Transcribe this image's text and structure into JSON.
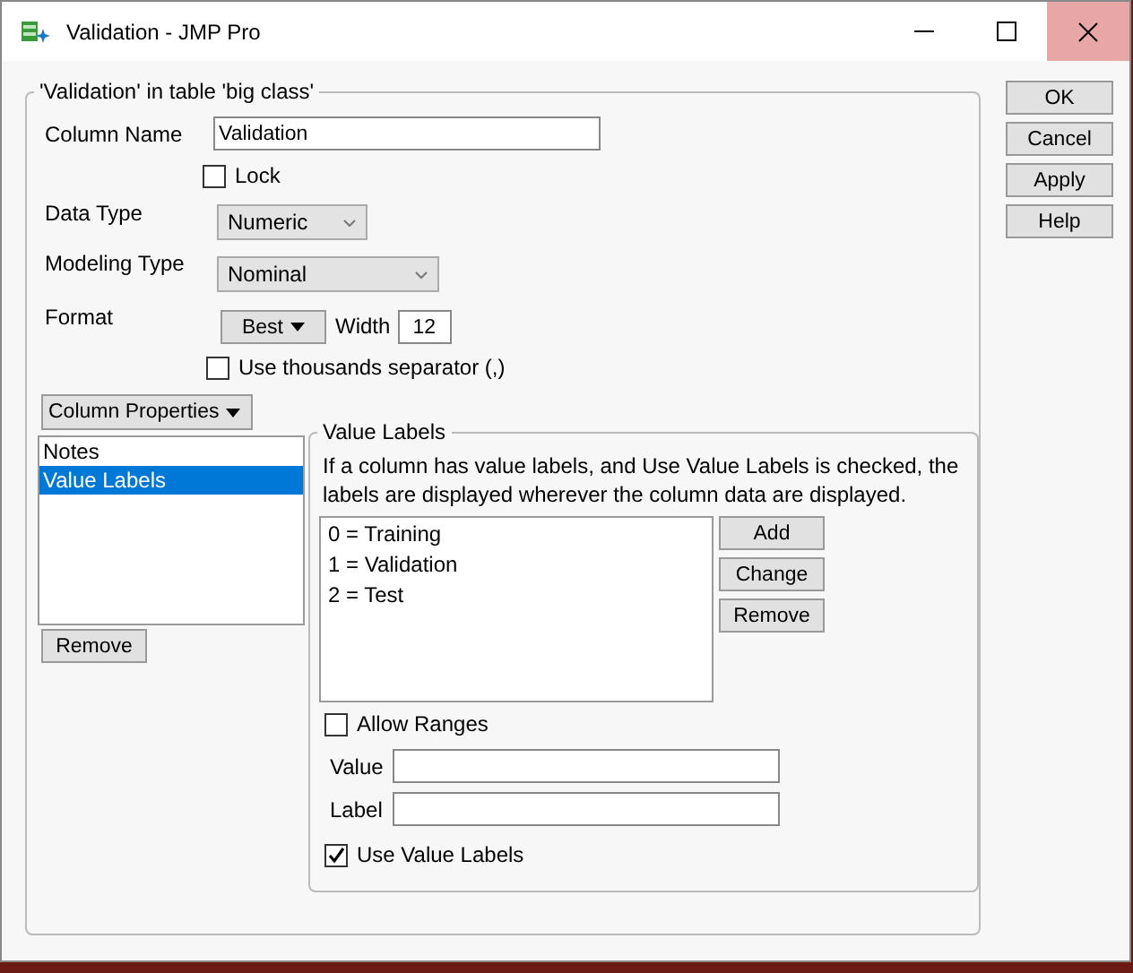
{
  "window": {
    "title": "Validation - JMP Pro"
  },
  "panel": {
    "title": "'Validation' in table 'big class'"
  },
  "column_name": {
    "label": "Column Name",
    "value": "Validation"
  },
  "lock": {
    "label": "Lock",
    "checked": false
  },
  "data_type": {
    "label": "Data Type",
    "value": "Numeric"
  },
  "modeling_type": {
    "label": "Modeling Type",
    "value": "Nominal"
  },
  "format": {
    "label": "Format",
    "button": "Best",
    "width_label": "Width",
    "width_value": "12"
  },
  "thousands_separator": {
    "label": "Use thousands separator (,)",
    "checked": false
  },
  "column_properties": {
    "button": "Column Properties",
    "items": [
      {
        "label": "Notes",
        "selected": false
      },
      {
        "label": "Value Labels",
        "selected": true
      }
    ],
    "remove": "Remove"
  },
  "value_labels": {
    "title": "Value Labels",
    "description": "If a column has value labels, and Use Value Labels is checked, the labels are displayed wherever the column data are displayed.",
    "items": [
      "0 = Training",
      "1 = Validation",
      "2 = Test"
    ],
    "buttons": [
      "Add",
      "Change",
      "Remove"
    ],
    "allow_ranges": {
      "label": "Allow Ranges",
      "checked": false
    },
    "value_field": {
      "label": "Value"
    },
    "label_field": {
      "label": "Label"
    },
    "use_value_labels": {
      "label": "Use Value Labels",
      "checked": true
    }
  },
  "buttons": [
    "OK",
    "Cancel",
    "Apply",
    "Help"
  ]
}
